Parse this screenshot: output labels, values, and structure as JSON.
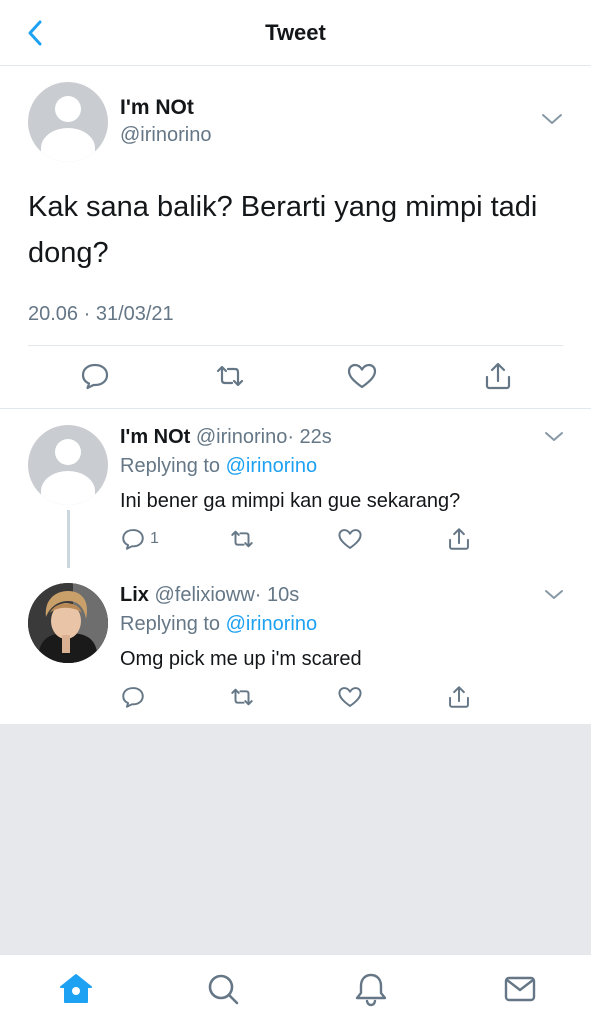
{
  "header": {
    "title": "Tweet",
    "back_icon": "chevron-left-icon"
  },
  "main_tweet": {
    "name": "I'm NOt",
    "handle": "@irinorino",
    "text": "Kak sana balik? Berarti yang mimpi tadi dong?",
    "timestamp": "20.06 · 31/03/21"
  },
  "replies": [
    {
      "name": "I'm NOt",
      "handle": "@irinorino",
      "time": "· 22s",
      "replying_prefix": "Replying to",
      "replying_to": "@irinorino",
      "text": "Ini bener ga mimpi kan gue sekarang?",
      "reply_count": "1"
    },
    {
      "name": "Lix",
      "handle": "@felixioww",
      "time": "· 10s",
      "replying_prefix": "Replying to",
      "replying_to": "@irinorino",
      "text": "Omg pick me up i'm scared",
      "reply_count": ""
    }
  ],
  "tabs": [
    "home-icon",
    "search-icon",
    "notifications-bell-icon",
    "messages-envelope-icon"
  ],
  "colors": {
    "accent": "#1da1f2",
    "secondary_text": "#657786",
    "border": "#e1e8ed",
    "empty_area": "#e6e8ec"
  }
}
